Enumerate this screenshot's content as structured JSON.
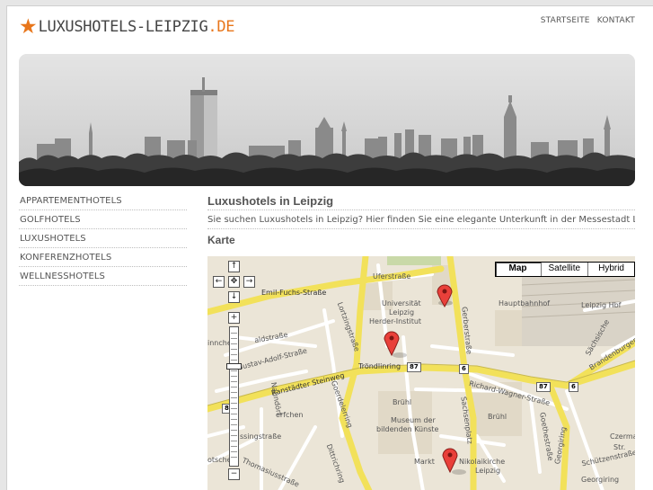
{
  "site": {
    "logo_name": "LUXUSHOTELS-LEIPZIG",
    "logo_tld": ".DE",
    "brand_color": "#e8761b",
    "topnav": [
      "STARTSEITE",
      "KONTAKT"
    ]
  },
  "sidenav": {
    "items": [
      "APPARTEMENTHOTELS",
      "GOLFHOTELS",
      "LUXUSHOTELS",
      "KONFERENZHOTELS",
      "WELLNESSHOTELS"
    ]
  },
  "main": {
    "title": "Luxushotels in Leipzig",
    "intro": "Sie suchen Luxushotels in Leipzig? Hier finden Sie eine elegante Unterkunft in der Messestadt Leipzig.",
    "map_heading": "Karte"
  },
  "map": {
    "types": [
      "Map",
      "Satellite",
      "Hybrid"
    ],
    "selected_type": "Map",
    "controls": {
      "pan_up": "↑",
      "pan_left": "←",
      "pan_center": "✥",
      "pan_right": "→",
      "pan_down": "↓",
      "zoom_in": "+",
      "zoom_out": "−"
    },
    "zoom_level": 0.72,
    "labels": {
      "uferstrasse": "Uferstraße",
      "emil_fuchs": "Emil-Fuchs-Straße",
      "uni1": "Universität",
      "uni2": "Leipzig",
      "uni3": "Herder-Institut",
      "hbf": "Hauptbahnhof",
      "hbf2": "Leipzig Hbf",
      "ranstaedter": "Ranstädter Steinweg",
      "troendlinring": "Tröndlinring",
      "goerdelerring": "Goerdelerring",
      "gerberstrasse": "Gerberstraße",
      "richard_wagner": "Richard-Wagner-Straße",
      "bruehl": "Brühl",
      "bruehl2": "Brühl",
      "museum1": "Museum der",
      "museum2": "bildenden Künste",
      "sachsenplatz": "Sachsenplatz",
      "markt": "Markt",
      "nikolaikirche1": "Nikolaikirche",
      "nikolaikirche2": "Leipzig",
      "goethestrasse": "Goethestraße",
      "georgiring": "Georgiring",
      "georgiring2": "Georgiring",
      "schuetzenstrasse": "Schützenstraße",
      "brandenburger": "Brandenburger Str.",
      "saechsische": "Sächsische",
      "thomasiusstrasse": "Thomasiusstraße",
      "dittrichring": "Dittrichring",
      "erfchen": "erfchen",
      "ssingstrasse": "ssingstraße",
      "gustav": "Gustav-Adolf-Straße",
      "lortzingstrasse": "Lortzingstraße",
      "innche": "innche",
      "aldstr": "aldstraße",
      "otsche": "otsche",
      "naundoerf": "Naundörf",
      "czerma": "Czerma",
      "str": "Str."
    },
    "shields": [
      "87",
      "6",
      "87",
      "6",
      "87"
    ]
  }
}
